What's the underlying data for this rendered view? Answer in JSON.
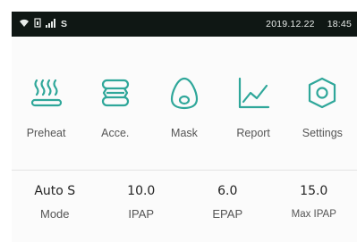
{
  "status": {
    "carrier": "S",
    "date": "2019.12.22",
    "time": "18:45"
  },
  "accent_color": "#2fa79a",
  "menu": [
    {
      "label": "Preheat",
      "icon": "heater-icon"
    },
    {
      "label": "Acce.",
      "icon": "accessory-icon"
    },
    {
      "label": "Mask",
      "icon": "mask-icon"
    },
    {
      "label": "Report",
      "icon": "chart-icon"
    },
    {
      "label": "Settings",
      "icon": "settings-icon"
    }
  ],
  "params": [
    {
      "value": "Auto S",
      "name": "Mode"
    },
    {
      "value": "10.0",
      "name": "IPAP"
    },
    {
      "value": "6.0",
      "name": "EPAP"
    },
    {
      "value": "15.0",
      "name": "Max IPAP"
    }
  ]
}
